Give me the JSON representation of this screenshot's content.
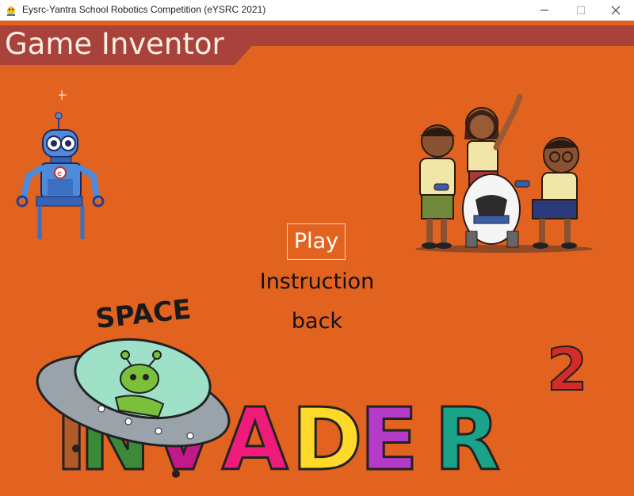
{
  "window": {
    "title": "Eysrc-Yantra School Robotics Competition (eYSRC 2021)"
  },
  "game": {
    "title": "Game Inventor",
    "menu": {
      "play": "Play",
      "instruction": "Instruction",
      "back": "back"
    },
    "logo": {
      "word_top": "SPACE",
      "word_main": "INVADER",
      "superscript": "2"
    }
  },
  "colors": {
    "background": "#e2621f",
    "header_band": "#a8423a",
    "play_border": "#f2d9c8"
  },
  "icons": [
    "app-icon",
    "minimize-icon",
    "maximize-icon",
    "close-icon",
    "robot-mascot",
    "kids-illustration",
    "space-invader-logo"
  ]
}
